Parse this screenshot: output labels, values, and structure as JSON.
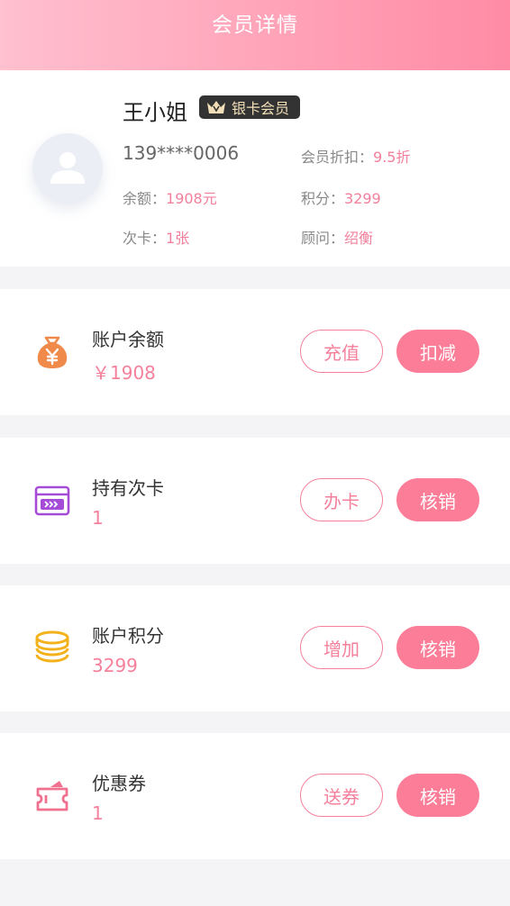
{
  "header": {
    "title": "会员详情"
  },
  "profile": {
    "name": "王小姐",
    "badge": "银卡会员",
    "phone": "139****0006",
    "discount_label": "会员折扣：",
    "discount_value": "9.5折",
    "balance_label": "余额：",
    "balance_value": "1908元",
    "points_label": "积分：",
    "points_value": "3299",
    "times_card_label": "次卡：",
    "times_card_value": "1张",
    "advisor_label": "顾问：",
    "advisor_value": "绍衡"
  },
  "cards": [
    {
      "title": "账户余额",
      "value": "￥1908",
      "icon": "money-bag-icon",
      "outline_button": "充值",
      "fill_button": "扣减"
    },
    {
      "title": "持有次卡",
      "value": "1",
      "icon": "times-card-icon",
      "outline_button": "办卡",
      "fill_button": "核销"
    },
    {
      "title": "账户积分",
      "value": "3299",
      "icon": "coins-stack-icon",
      "outline_button": "增加",
      "fill_button": "核销"
    },
    {
      "title": "优惠券",
      "value": "1",
      "icon": "coupon-ticket-icon",
      "outline_button": "送券",
      "fill_button": "核销"
    }
  ],
  "colors": {
    "header_start": "#ffc0cf",
    "header_end": "#ff8ba5",
    "accent": "#fb7d97",
    "value_pink": "#f27f9b",
    "badge_bg": "#333333",
    "badge_text": "#f2dfb8"
  }
}
